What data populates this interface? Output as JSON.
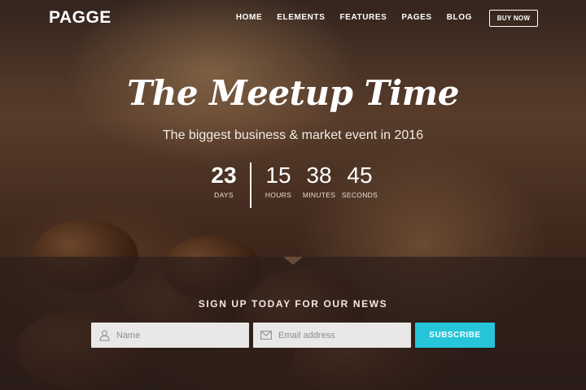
{
  "brand": {
    "logo": "PAGGE"
  },
  "nav": {
    "items": [
      {
        "label": "HOME"
      },
      {
        "label": "ELEMENTS"
      },
      {
        "label": "FEATURES"
      },
      {
        "label": "PAGES"
      },
      {
        "label": "BLOG"
      }
    ],
    "cta_label": "BUY NOW"
  },
  "hero": {
    "title": "The Meetup Time",
    "subtitle": "The biggest business & market event in 2016",
    "countdown": {
      "days": {
        "value": "23",
        "label": "DAYS"
      },
      "hours": {
        "value": "15",
        "label": "HOURS"
      },
      "minutes": {
        "value": "38",
        "label": "MINUTES"
      },
      "seconds": {
        "value": "45",
        "label": "SECONDS"
      }
    }
  },
  "signup": {
    "heading": "SIGN UP TODAY FOR OUR NEWS",
    "name_placeholder": "Name",
    "email_placeholder": "Email address",
    "submit_label": "SUBSCRIBE",
    "submit_color": "#26c5d9"
  },
  "icons": {
    "name_field": "user-icon",
    "email_field": "envelope-icon"
  }
}
